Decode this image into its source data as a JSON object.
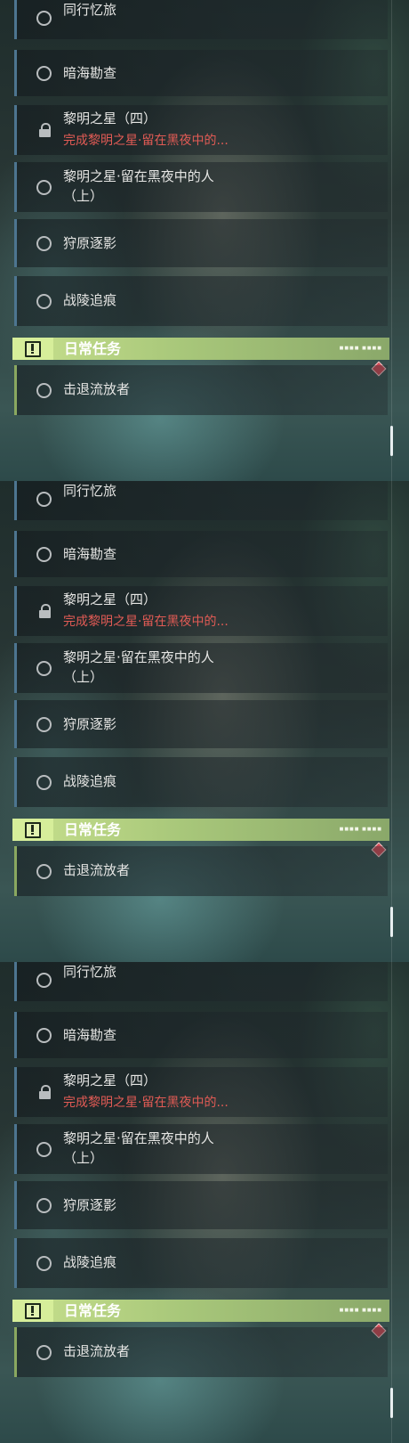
{
  "panels": [
    {
      "quests": [
        {
          "title": "同行忆旅",
          "locked": false
        },
        {
          "title": "暗海勘查",
          "locked": false
        },
        {
          "title": "黎明之星（四）",
          "locked": true,
          "subtitle": "完成黎明之星·留在黑夜中的..."
        },
        {
          "title": "黎明之星·留在黑夜中的人",
          "title_line2": "（上）",
          "locked": false
        },
        {
          "title": "狩原逐影",
          "locked": false
        },
        {
          "title": "战陵追痕",
          "locked": false
        }
      ],
      "section_title": "日常任务",
      "daily_quest": "击退流放者"
    },
    {
      "quests": [
        {
          "title": "同行忆旅",
          "locked": false
        },
        {
          "title": "暗海勘查",
          "locked": false
        },
        {
          "title": "黎明之星（四）",
          "locked": true,
          "subtitle": "完成黎明之星·留在黑夜中的..."
        },
        {
          "title": "黎明之星·留在黑夜中的人",
          "title_line2": "（上）",
          "locked": false
        },
        {
          "title": "狩原逐影",
          "locked": false
        },
        {
          "title": "战陵追痕",
          "locked": false
        }
      ],
      "section_title": "日常任务",
      "daily_quest": "击退流放者"
    },
    {
      "quests": [
        {
          "title": "同行忆旅",
          "locked": false
        },
        {
          "title": "暗海勘查",
          "locked": false
        },
        {
          "title": "黎明之星（四）",
          "locked": true,
          "subtitle": "完成黎明之星·留在黑夜中的..."
        },
        {
          "title": "黎明之星·留在黑夜中的人",
          "title_line2": "（上）",
          "locked": false
        },
        {
          "title": "狩原逐影",
          "locked": false
        },
        {
          "title": "战陵追痕",
          "locked": false
        }
      ],
      "section_title": "日常任务",
      "daily_quest": "击退流放者"
    }
  ],
  "colors": {
    "accent_green": "#c7e08d",
    "warning_red": "#e25b55",
    "quest_border": "#4d7590"
  },
  "icons": {
    "quest": "circle-icon",
    "locked": "lock-icon",
    "section": "exclamation-box-icon",
    "marker": "diamond-marker-icon"
  }
}
